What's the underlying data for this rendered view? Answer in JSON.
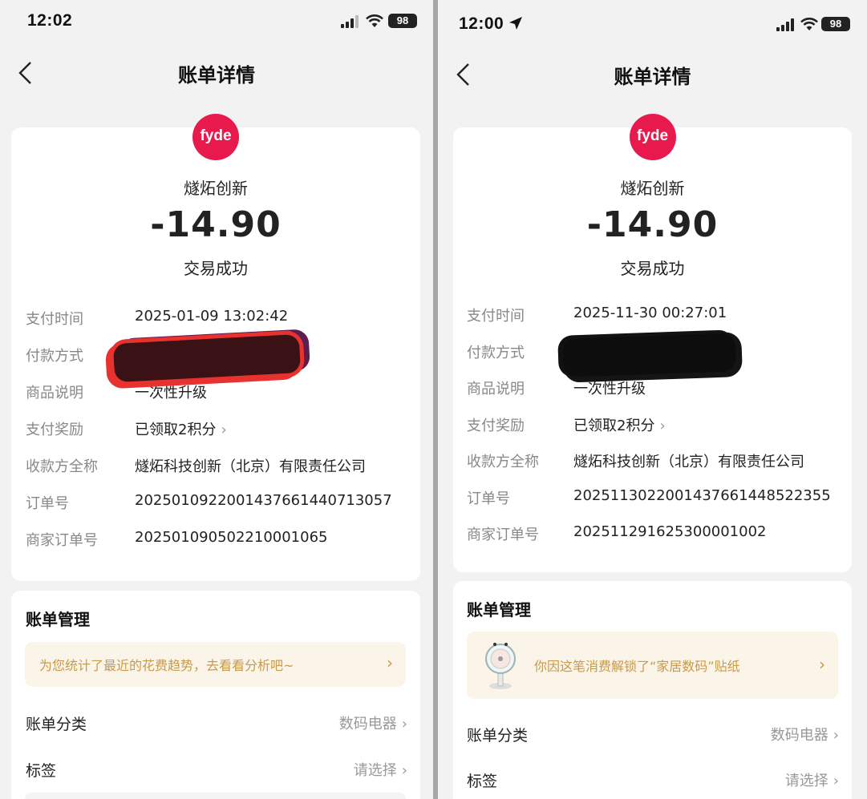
{
  "left": {
    "status_time": "12:02",
    "battery": "98",
    "nav_title": "账单详情",
    "logo_text": "fyde",
    "merchant": "燧炻创新",
    "amount": "-14.90",
    "status": "交易成功",
    "rows": [
      {
        "label": "支付时间",
        "value": "2025-01-09 13:02:42"
      },
      {
        "label": "付款方式",
        "value": ""
      },
      {
        "label": "商品说明",
        "value": "一次性升级"
      },
      {
        "label": "支付奖励",
        "value": "已领取2积分"
      },
      {
        "label": "收款方全称",
        "value": "燧炻科技创新（北京）有限责任公司"
      },
      {
        "label": "订单号",
        "value": "2025010922001437661440713057"
      },
      {
        "label": "商家订单号",
        "value": "20250109050221000106​5"
      }
    ],
    "manage": {
      "title": "账单管理",
      "banner": "为您统计了最近的花费趋势，去看看分析吧~",
      "category_label": "账单分类",
      "category_value": "数码电器",
      "tag_label": "标签",
      "tag_value": "请选择"
    }
  },
  "right": {
    "status_time": "12:00",
    "battery": "98",
    "nav_title": "账单详情",
    "logo_text": "fyde",
    "merchant": "燧炻创新",
    "amount": "-14.90",
    "status": "交易成功",
    "rows": [
      {
        "label": "支付时间",
        "value": "2025-11-30 00:27:01"
      },
      {
        "label": "付款方式",
        "value": ""
      },
      {
        "label": "商品说明",
        "value": "一次性升级"
      },
      {
        "label": "支付奖励",
        "value": "已领取2积分"
      },
      {
        "label": "收款方全称",
        "value": "燧炻科技创新（北京）有限责任公司"
      },
      {
        "label": "订单号",
        "value": "2025113022001437661448522355"
      },
      {
        "label": "商家订单号",
        "value": "20251129162530000100​2"
      }
    ],
    "manage": {
      "title": "账单管理",
      "banner": "你因这笔消费解锁了“家居数码”贴纸",
      "category_label": "账单分类",
      "category_value": "数码电器",
      "tag_label": "标签",
      "tag_value": "请选择"
    }
  },
  "chevron": "›",
  "colors": {
    "brand": "#e8194c",
    "banner_text": "#c89a4b",
    "banner_bg": "#fbf4e8"
  }
}
